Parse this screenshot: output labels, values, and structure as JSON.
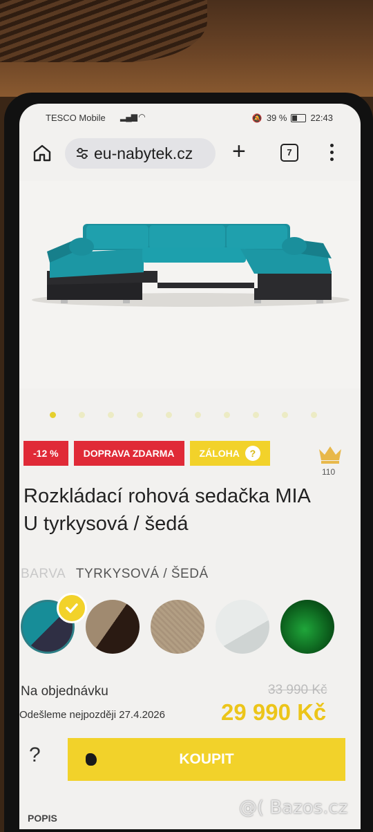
{
  "status_bar": {
    "carrier": "TESCO Mobile",
    "battery": "39 %",
    "time": "22:43"
  },
  "browser": {
    "url": "eu-nabytek.cz",
    "new_tab": "+",
    "tab_count": "7"
  },
  "gallery": {
    "dot_count": 10,
    "active_index": 0
  },
  "badges": {
    "discount": "-12 %",
    "free_shipping": "DOPRAVA ZDARMA",
    "deposit": "ZÁLOHA",
    "deposit_help": "?"
  },
  "rating": {
    "count": "110"
  },
  "product": {
    "title": "Rozkládací rohová sedačka MIA U tyrkysová / šedá",
    "color_label": "BARVA",
    "color_value": "TYRKYSOVÁ / ŠEDÁ"
  },
  "swatches": [
    {
      "name": "tyrkysová / šedá",
      "selected": true
    },
    {
      "name": "hnědá",
      "selected": false
    },
    {
      "name": "béžová",
      "selected": false
    },
    {
      "name": "bílá",
      "selected": false
    },
    {
      "name": "zelená",
      "selected": false
    }
  ],
  "purchase": {
    "availability": "Na objednávku",
    "shipping": "Odešleme nejpozději 27.4.2026",
    "old_price": "33 990 Kč",
    "price": "29 990 Kč",
    "help": "?",
    "buy_label": "KOUPIT"
  },
  "footer": {
    "section": "POPIS"
  },
  "watermark": "@( Bazos.cz",
  "colors": {
    "accent_yellow": "#f2d22a",
    "badge_red": "#e02a37",
    "price_yellow": "#ecc51a",
    "sofa_teal": "#1a9aa6"
  }
}
